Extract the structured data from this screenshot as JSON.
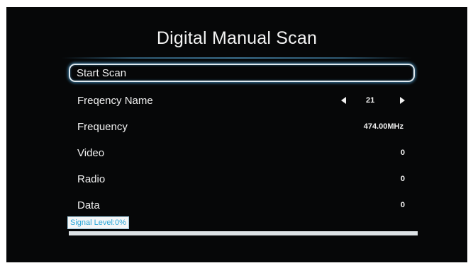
{
  "screen": {
    "title": "Digital Manual Scan",
    "start_scan_label": "Start Scan",
    "freq_name": {
      "label": "Freqency Name",
      "value": "21"
    },
    "frequency": {
      "label": "Frequency",
      "value": "474.00MHz"
    },
    "video": {
      "label": "Video",
      "value": "0"
    },
    "radio": {
      "label": "Radio",
      "value": "0"
    },
    "data_row": {
      "label": "Data",
      "value": "0"
    },
    "signal": {
      "label": "Signal Level:0%",
      "level": 0
    }
  },
  "icons": {
    "left": "arrow-left-icon",
    "right": "arrow-right-icon"
  },
  "colors": {
    "background": "#060708",
    "accent": "#2aa7d8",
    "text": "#f0f0f0"
  }
}
